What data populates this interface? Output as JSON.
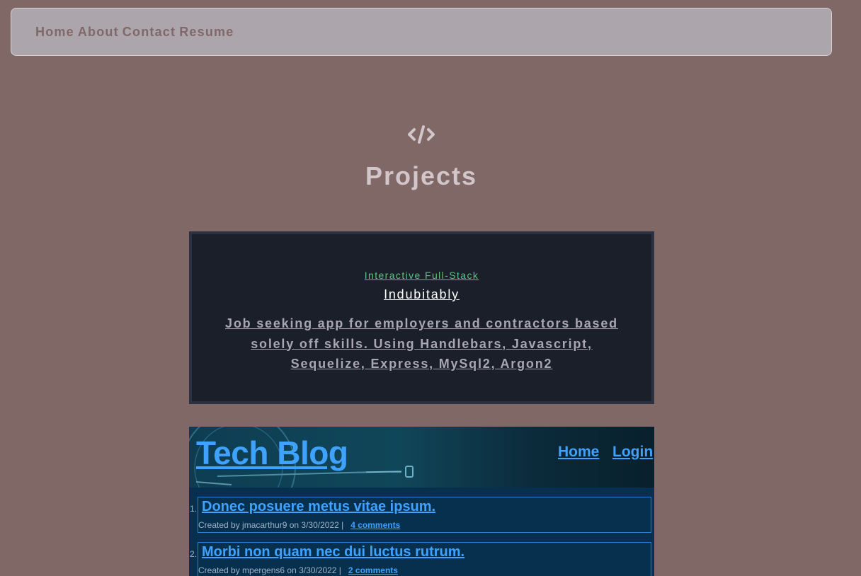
{
  "nav": {
    "items": [
      {
        "label": "Home"
      },
      {
        "label": "About"
      },
      {
        "label": "Contact"
      },
      {
        "label": "Resume"
      }
    ]
  },
  "section": {
    "icon": "code-icon",
    "title": "Projects"
  },
  "project": {
    "category": "Interactive Full-Stack",
    "name": "Indubitably",
    "description": "Job seeking app for employers and contractors based solely off skills. Using Handlebars, Javascript, Sequelize, Express, MySql2, Argon2"
  },
  "preview": {
    "title": "Tech Blog",
    "nav": [
      "Home",
      "Login"
    ],
    "posts": [
      {
        "number": "1.",
        "title": "Donec posuere metus vitae ipsum.",
        "meta": "Created by jmacarthur9 on 3/30/2022 |",
        "comments": "4 comments"
      },
      {
        "number": "2.",
        "title": "Morbi non quam nec dui luctus rutrum.",
        "meta": "Created by mpergens6 on 3/30/2022 |",
        "comments": "2 comments"
      }
    ]
  },
  "colors": {
    "background": "#806867",
    "navbar": "#aca5ac",
    "card": "#1a1f2a",
    "category": "#5dc37f",
    "link_blue": "#3fa2ff"
  }
}
